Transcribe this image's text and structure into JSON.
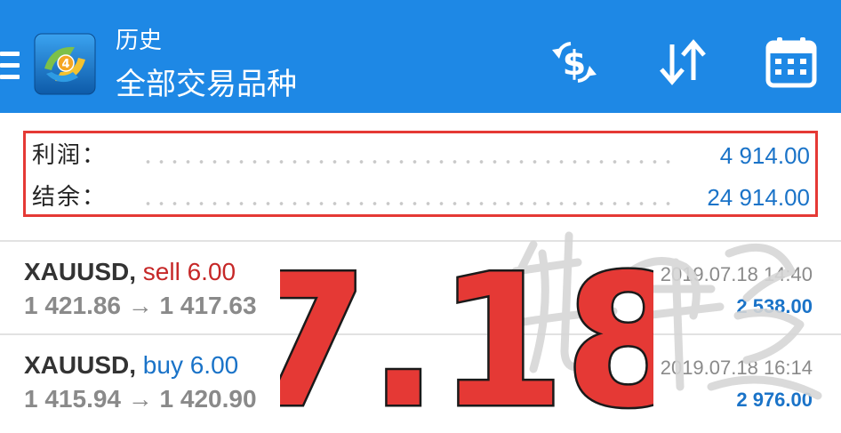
{
  "header": {
    "title": "历史",
    "subtitle": "全部交易品种",
    "background": "#1e88e5"
  },
  "summary": {
    "profit_label": "利润：",
    "profit_value": "4 914.00",
    "balance_label": "结余：",
    "balance_value": "24 914.00",
    "highlight_color": "#e53935"
  },
  "deals": [
    {
      "symbol": "XAUUSD,",
      "side": "sell 6.00",
      "prices": "1 421.86 → 1 417.63",
      "time": "2019.07.18 14:40",
      "profit": "2 538.00"
    },
    {
      "symbol": "XAUUSD,",
      "side": "buy 6.00",
      "prices": "1 415.94 → 1 420.90",
      "time": "2019.07.18 16:14",
      "profit": "2 976.00"
    }
  ],
  "overlay": {
    "date_text": "7.18",
    "date_color": "#e53935"
  },
  "colors": {
    "accent": "#1a73c8",
    "sell": "#c62828",
    "muted": "#8a8a8a"
  },
  "icons": {
    "menu": "menu-icon",
    "logo": "metatrader-logo-icon",
    "currency": "currency-exchange-icon",
    "sort": "sort-icon",
    "calendar": "calendar-icon"
  }
}
